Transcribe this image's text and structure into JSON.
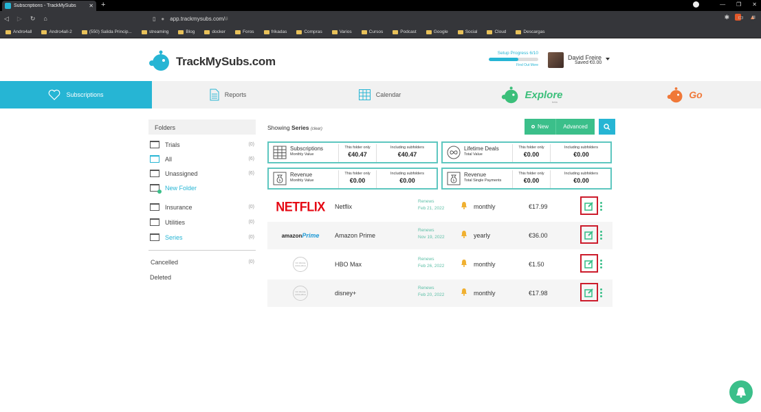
{
  "browser": {
    "tab_title": "Subscriptions - TrackMySubs",
    "url_host": "app.trackmysubs.com/",
    "url_hash": "#",
    "bookmarks": [
      "Andro4all",
      "Andro4all-2",
      "(550) Salida Princip...",
      "streaming",
      "Blog",
      "docker",
      "Foros",
      "frikadas",
      "Compras",
      "Varios",
      "Cursos",
      "Podcast",
      "Google",
      "Social",
      "Cloud",
      "Descargas"
    ]
  },
  "header": {
    "logo_text": "TrackMySubs.com",
    "setup_label": "Setup Progress 6/10",
    "setup_progress": 0.6,
    "find_out_more": "Find Out More",
    "user_name": "David Freire",
    "user_saved": "Saved €0.00"
  },
  "nav": {
    "subscriptions": "Subscriptions",
    "reports": "Reports",
    "calendar": "Calendar",
    "explore": "Explore",
    "explore_sub": "beta",
    "go": "Go"
  },
  "sidebar": {
    "heading": "Folders",
    "items": [
      {
        "label": "Trials",
        "count": "(0)"
      },
      {
        "label": "All",
        "count": "(6)"
      },
      {
        "label": "Unassigned",
        "count": "(6)"
      },
      {
        "label": "New Folder",
        "count": ""
      },
      {
        "label": "Insurance",
        "count": "(0)"
      },
      {
        "label": "Utilities",
        "count": "(0)"
      },
      {
        "label": "Series",
        "count": "(0)"
      }
    ],
    "cancelled": "Cancelled",
    "cancelled_count": "(0)",
    "deleted": "Deleted"
  },
  "main": {
    "showing_prefix": "Showing ",
    "showing_folder": "Series",
    "clear": "(clear)",
    "new_button": "New",
    "advanced_button": "Advanced",
    "cards": [
      {
        "title": "Subscriptions",
        "subtitle": "Monthly Value",
        "col1_label": "This folder only",
        "col1_value": "€40.47",
        "col2_label": "Including subfolders",
        "col2_value": "€40.47"
      },
      {
        "title": "Lifetime Deals",
        "subtitle": "Total Value",
        "col1_label": "This folder only",
        "col1_value": "€0.00",
        "col2_label": "Including subfolders",
        "col2_value": "€0.00"
      },
      {
        "title": "Revenue",
        "subtitle": "Monthly Value",
        "col1_label": "This folder only",
        "col1_value": "€0.00",
        "col2_label": "Including subfolders",
        "col2_value": "€0.00"
      },
      {
        "title": "Revenue",
        "subtitle": "Total Single Payments",
        "col1_label": "This folder only",
        "col1_value": "€0.00",
        "col2_label": "Including subfolders",
        "col2_value": "€0.00"
      }
    ],
    "subscriptions": [
      {
        "logo": "NETFLIX",
        "name": "Netflix",
        "renews_label": "Renews",
        "renews_date": "Feb 21, 2022",
        "frequency": "monthly",
        "price": "€17.99"
      },
      {
        "logo": "amazon Prime",
        "name": "Amazon Prime",
        "renews_label": "Renews",
        "renews_date": "Nov 19, 2022",
        "frequency": "yearly",
        "price": "€36.00"
      },
      {
        "logo": "NO IMAGE AVAILABLE",
        "name": "HBO Max",
        "renews_label": "Renews",
        "renews_date": "Feb 26, 2022",
        "frequency": "monthly",
        "price": "€1.50"
      },
      {
        "logo": "NO IMAGE AVAILABLE",
        "name": "disney+",
        "renews_label": "Renews",
        "renews_date": "Feb 20, 2022",
        "frequency": "monthly",
        "price": "€17.98"
      }
    ]
  },
  "colors": {
    "accent": "#26b5d4",
    "green": "#3bbf8a",
    "orange": "#f07838",
    "highlight": "#cc1a2a"
  },
  "icons": [
    "heart-icon",
    "reports-icon",
    "calendar-icon",
    "explore-icon",
    "go-icon",
    "folder-icon",
    "plus-icon",
    "search-icon",
    "bell-icon",
    "edit-icon",
    "more-icon",
    "chat-icon"
  ]
}
